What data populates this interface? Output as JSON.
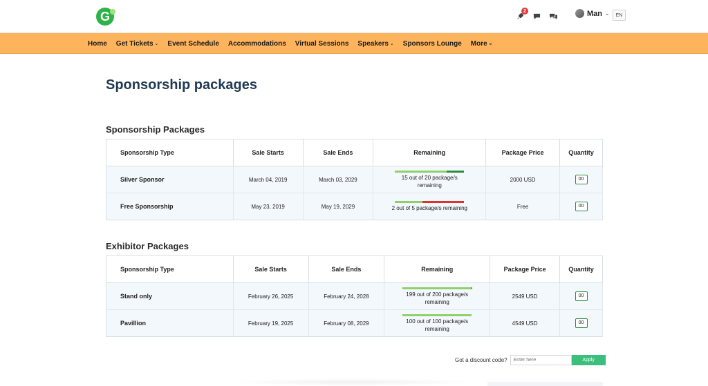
{
  "brand": {
    "logo_letter": "G"
  },
  "header": {
    "notification_count": "2",
    "user_name": "Man",
    "language": "EN"
  },
  "nav": [
    {
      "label": "Home",
      "dropdown": false
    },
    {
      "label": "Get Tickets",
      "dropdown": true
    },
    {
      "label": "Event Schedule",
      "dropdown": false
    },
    {
      "label": "Accommodations",
      "dropdown": false
    },
    {
      "label": "Virtual Sessions",
      "dropdown": false
    },
    {
      "label": "Speakers",
      "dropdown": true
    },
    {
      "label": "Sponsors Lounge",
      "dropdown": false
    },
    {
      "label": "More",
      "dropdown": true
    }
  ],
  "page_title": "Sponsorship packages",
  "columns": [
    "Sponsorship Type",
    "Sale Starts",
    "Sale Ends",
    "Remaining",
    "Package Price",
    "Quantity"
  ],
  "sponsorship": {
    "title": "Sponsorship Packages",
    "rows": [
      {
        "type": "Silver Sponsor",
        "start": "March 04, 2019",
        "end": "March 03, 2029",
        "remaining": "15 out of 20 package/s remaining",
        "remaining_fraction": 0.75,
        "used_color": "#2e8b3d",
        "price": "2000 USD",
        "qty": "00"
      },
      {
        "type": "Free Sponsorship",
        "start": "May 23, 2019",
        "end": "May 19, 2029",
        "remaining": "2 out of 5 package/s remaining",
        "remaining_fraction": 0.4,
        "used_color": "#e03131",
        "price": "Free",
        "qty": "00"
      }
    ]
  },
  "exhibitor": {
    "title": "Exhibitor Packages",
    "rows": [
      {
        "type": "Stand only",
        "start": "February 26, 2025",
        "end": "February 24, 2028",
        "remaining": "199 out of 200 package/s remaining",
        "remaining_fraction": 0.995,
        "used_color": "#2e8b3d",
        "price": "2549 USD",
        "qty": "00"
      },
      {
        "type": "Pavillion",
        "start": "February 19, 2025",
        "end": "February 08, 2029",
        "remaining": "100 out of 100 package/s remaining",
        "remaining_fraction": 1.0,
        "used_color": "#2e8b3d",
        "price": "4549 USD",
        "qty": "00"
      }
    ]
  },
  "discount": {
    "label": "Got a discount code?",
    "placeholder": "Enter here",
    "button": "Apply"
  },
  "colors": {
    "nav_bg": "#fdb45c",
    "title": "#1f3a52",
    "bar_remaining": "#8fd06b",
    "apply_button": "#3bbf7c"
  }
}
